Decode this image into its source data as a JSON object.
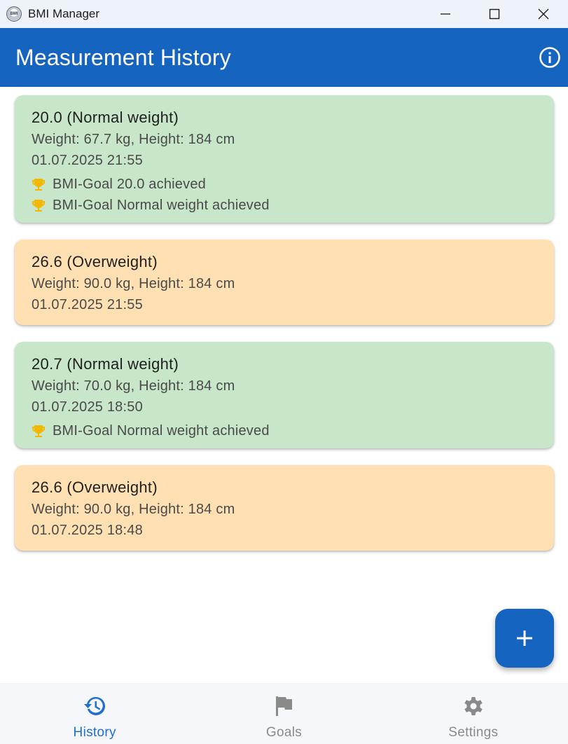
{
  "window": {
    "app_title": "BMI Manager",
    "app_icon_text": "BMI",
    "minimize_icon": "minimize-icon",
    "maximize_icon": "maximize-icon",
    "close_icon": "close-icon"
  },
  "appbar": {
    "title": "Measurement History",
    "info_icon": "info-icon"
  },
  "colors": {
    "primary": "#1565c0",
    "normal_card": "#c8e6c9",
    "overweight_card": "#ffe0b2",
    "trophy": "#f5b700",
    "nav_active": "#1e6fd0",
    "nav_inactive": "#8a8a8a"
  },
  "measurements": [
    {
      "title": "20.0 (Normal weight)",
      "details": "Weight: 67.7 kg, Height: 184 cm",
      "timestamp": "01.07.2025 21:55",
      "category": "normal",
      "achievements": [
        "BMI-Goal 20.0 achieved",
        "BMI-Goal Normal weight achieved"
      ]
    },
    {
      "title": "26.6 (Overweight)",
      "details": "Weight: 90.0 kg, Height: 184 cm",
      "timestamp": "01.07.2025 21:55",
      "category": "overweight",
      "achievements": []
    },
    {
      "title": "20.7 (Normal weight)",
      "details": "Weight: 70.0 kg, Height: 184 cm",
      "timestamp": "01.07.2025 18:50",
      "category": "normal",
      "achievements": [
        "BMI-Goal Normal weight achieved"
      ]
    },
    {
      "title": "26.6 (Overweight)",
      "details": "Weight: 90.0 kg, Height: 184 cm",
      "timestamp": "01.07.2025 18:48",
      "category": "overweight",
      "achievements": []
    }
  ],
  "fab": {
    "icon": "plus-icon"
  },
  "bottom_nav": [
    {
      "label": "History",
      "icon": "history-icon",
      "active": true
    },
    {
      "label": "Goals",
      "icon": "flag-icon",
      "active": false
    },
    {
      "label": "Settings",
      "icon": "gear-icon",
      "active": false
    }
  ]
}
